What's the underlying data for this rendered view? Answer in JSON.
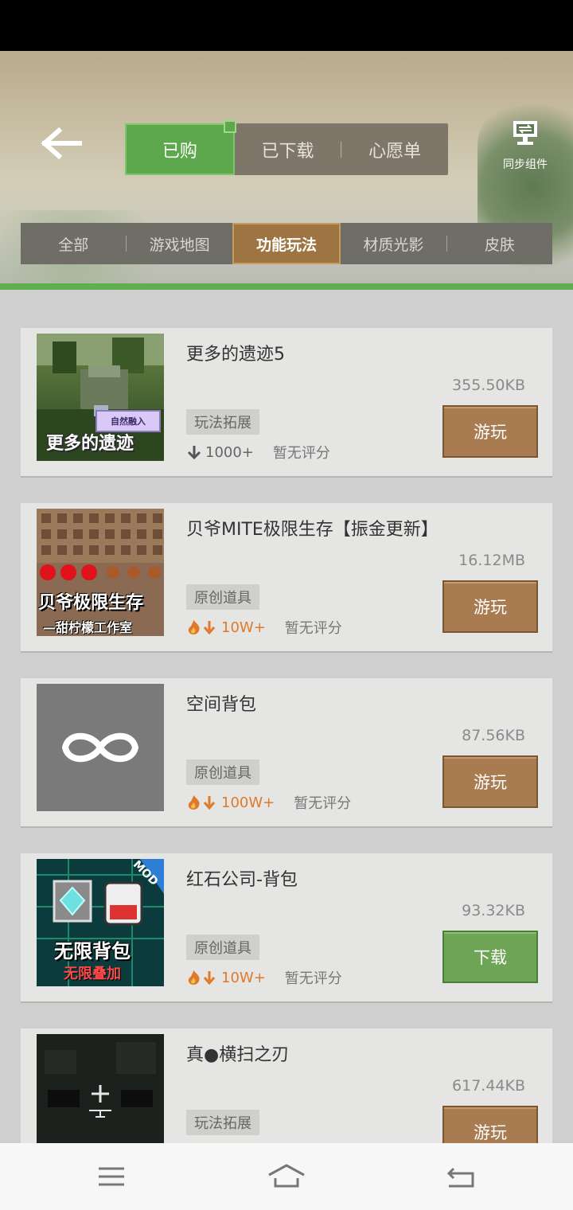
{
  "header": {
    "tabs": [
      {
        "label": "已购",
        "active": true
      },
      {
        "label": "已下载",
        "active": false
      },
      {
        "label": "心愿单",
        "active": false
      }
    ],
    "sync_label": "同步组件"
  },
  "categories": [
    {
      "label": "全部",
      "active": false
    },
    {
      "label": "游戏地图",
      "active": false
    },
    {
      "label": "功能玩法",
      "active": true
    },
    {
      "label": "材质光影",
      "active": false
    },
    {
      "label": "皮肤",
      "active": false
    }
  ],
  "items": [
    {
      "title": "更多的遗迹5",
      "size": "355.50KB",
      "tag": "玩法拓展",
      "downloads": "1000+",
      "hot": false,
      "rating": "暂无评分",
      "button": "游玩",
      "thumb_text": "更多的遗迹",
      "thumb_badge": "自然融入"
    },
    {
      "title": "贝爷MITE极限生存【振金更新】",
      "size": "16.12MB",
      "tag": "原创道具",
      "downloads": "10W+",
      "hot": true,
      "rating": "暂无评分",
      "button": "游玩",
      "thumb_text": "贝爷极限生存",
      "thumb_sub": "—甜柠檬工作室"
    },
    {
      "title": "空间背包",
      "size": "87.56KB",
      "tag": "原创道具",
      "downloads": "100W+",
      "hot": true,
      "rating": "暂无评分",
      "button": "游玩"
    },
    {
      "title": "红石公司-背包",
      "size": "93.32KB",
      "tag": "原创道具",
      "downloads": "10W+",
      "hot": true,
      "rating": "暂无评分",
      "button": "下载",
      "thumb_text": "无限背包",
      "thumb_sub": "无限叠加",
      "thumb_badge": "MOD"
    },
    {
      "title": "真●横扫之刃",
      "size": "617.44KB",
      "tag": "玩法拓展",
      "downloads": "",
      "hot": false,
      "rating": "",
      "button": "游玩"
    }
  ],
  "colors": {
    "active_green": "#5da84c",
    "play_brown": "#a87c50",
    "download_green": "#6da455",
    "hot_orange": "#e07a2a"
  }
}
